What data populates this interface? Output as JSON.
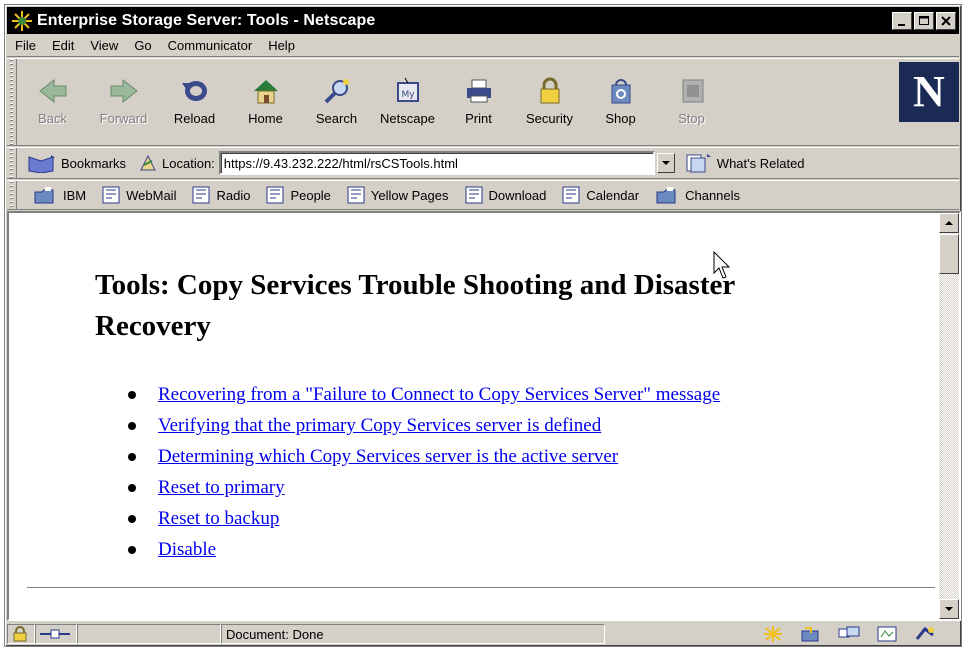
{
  "window": {
    "title": "Enterprise Storage Server: Tools - Netscape",
    "controls": [
      "minimize-icon",
      "maximize-icon",
      "close-icon"
    ]
  },
  "menubar": {
    "items": [
      "File",
      "Edit",
      "View",
      "Go",
      "Communicator",
      "Help"
    ]
  },
  "navigation_toolbar": {
    "buttons": [
      {
        "label": "Back",
        "icon": "back-arrow-icon",
        "enabled": false
      },
      {
        "label": "Forward",
        "icon": "forward-arrow-icon",
        "enabled": false
      },
      {
        "label": "Reload",
        "icon": "reload-icon",
        "enabled": true
      },
      {
        "label": "Home",
        "icon": "home-icon",
        "enabled": true
      },
      {
        "label": "Search",
        "icon": "search-icon",
        "enabled": true
      },
      {
        "label": "Netscape",
        "icon": "my-netscape-icon",
        "enabled": true
      },
      {
        "label": "Print",
        "icon": "printer-icon",
        "enabled": true
      },
      {
        "label": "Security",
        "icon": "padlock-icon",
        "enabled": true
      },
      {
        "label": "Shop",
        "icon": "shopping-bag-icon",
        "enabled": true
      },
      {
        "label": "Stop",
        "icon": "stop-icon",
        "enabled": false
      }
    ],
    "logo": "N"
  },
  "location_toolbar": {
    "bookmarks_label": "Bookmarks",
    "location_label": "Location:",
    "url": "https://9.43.232.222/html/rsCSTools.html",
    "related_label": "What's Related"
  },
  "personal_toolbar": {
    "items": [
      {
        "label": "IBM",
        "icon": "folder-icon"
      },
      {
        "label": "WebMail",
        "icon": "bookmark-page-icon"
      },
      {
        "label": "Radio",
        "icon": "bookmark-page-icon"
      },
      {
        "label": "People",
        "icon": "bookmark-page-icon"
      },
      {
        "label": "Yellow Pages",
        "icon": "bookmark-page-icon"
      },
      {
        "label": "Download",
        "icon": "bookmark-page-icon"
      },
      {
        "label": "Calendar",
        "icon": "bookmark-page-icon"
      },
      {
        "label": "Channels",
        "icon": "folder-icon"
      }
    ]
  },
  "page": {
    "heading": "Tools: Copy Services Trouble Shooting and Disaster Recovery",
    "links": [
      "Recovering from a \"Failure to Connect to Copy Services Server\" message",
      "Verifying that the primary Copy Services server is defined",
      "Determining which Copy Services server is the active server",
      "Reset to primary",
      "Reset to backup",
      "Disable"
    ],
    "link_color": "#0000ee"
  },
  "statusbar": {
    "status_text": "Document: Done"
  },
  "colors": {
    "titlebar_bg": "#000000",
    "chrome_bg": "#d4d0c8",
    "logo_bg": "#1a2a55"
  }
}
